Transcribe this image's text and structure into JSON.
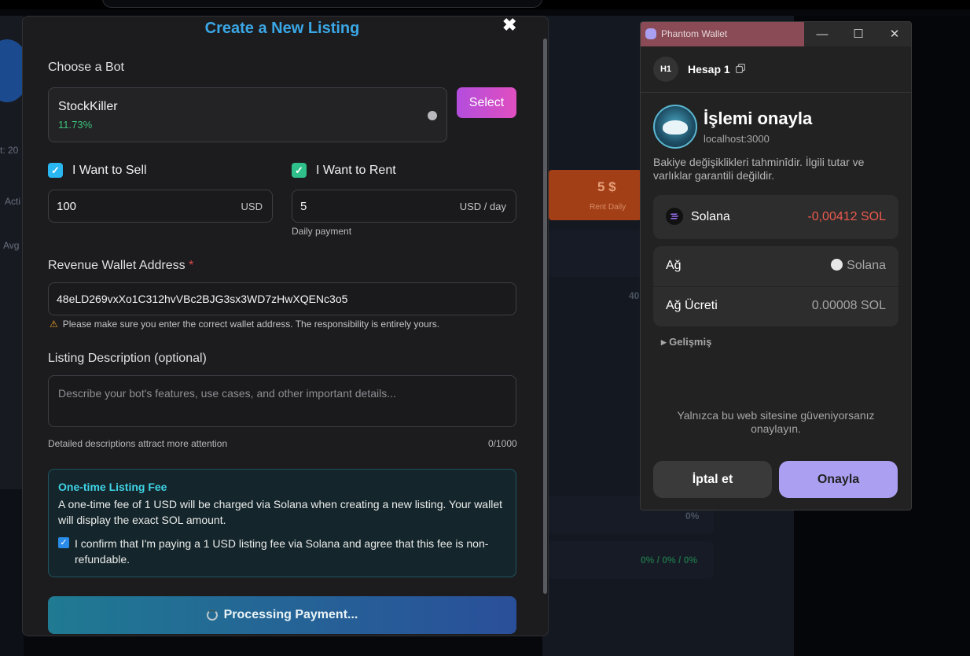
{
  "background": {
    "stub_text_1": "t: 20",
    "stub_text_2": "Acti",
    "stub_text_3": "Avg",
    "rent_price": "5 $",
    "rent_label": "Rent Daily",
    "num_40": "40",
    "pct_0": "0%",
    "pct_triple": [
      "0%",
      "0%",
      "0%"
    ]
  },
  "modal": {
    "title": "Create a New Listing",
    "close_glyph": "✖",
    "choose_bot_label": "Choose a Bot",
    "bot": {
      "name": "StockKiller",
      "performance": "11.73%"
    },
    "select_button": "Select",
    "sell": {
      "label": "I Want to Sell",
      "checked": true,
      "value": "100",
      "unit": "USD"
    },
    "rent": {
      "label": "I Want to Rent",
      "checked": true,
      "value": "5",
      "unit": "USD / day",
      "helper": "Daily payment"
    },
    "wallet": {
      "label": "Revenue Wallet Address",
      "required_mark": "*",
      "value": "48eLD269vxXo1C312hvVBc2BJG3sx3WD7zHwXQENc3o5",
      "warning": "Please make sure you enter the correct wallet address. The responsibility is entirely yours."
    },
    "description": {
      "label": "Listing Description (optional)",
      "placeholder": "Describe your bot's features, use cases, and other important details...",
      "helper": "Detailed descriptions attract more attention",
      "counter": "0/1000"
    },
    "fee": {
      "title": "One-time Listing Fee",
      "text": "A one-time fee of 1 USD will be charged via Solana when creating a new listing. Your wallet will display the exact SOL amount.",
      "confirm_text": "I confirm that I'm paying a 1 USD listing fee via Solana and agree that this fee is non-refundable.",
      "confirmed": true
    },
    "submit_button": "Processing Payment..."
  },
  "phantom": {
    "window_title": "Phantom Wallet",
    "account_badge": "H1",
    "account_name": "Hesap 1",
    "heading": "İşlemi onayla",
    "host": "localhost:3000",
    "notice": "Bakiye değişiklikleri tahminîdir. İlgili tutar ve varlıklar garantili değildir.",
    "asset": {
      "name": "Solana",
      "amount": "-0,00412 SOL"
    },
    "network_label": "Ağ",
    "network_value": "Solana",
    "fee_label": "Ağ Ücreti",
    "fee_value": "0.00008 SOL",
    "advanced_label": "Gelişmiş",
    "trust_notice": "Yalnızca bu web sitesine güveniyorsanız onaylayın.",
    "cancel_button": "İptal et",
    "confirm_button": "Onayla",
    "colors": {
      "confirm": "#ab9ff2",
      "negative": "#eb5a4e",
      "titlebar_accent": "#8a4b56"
    }
  }
}
